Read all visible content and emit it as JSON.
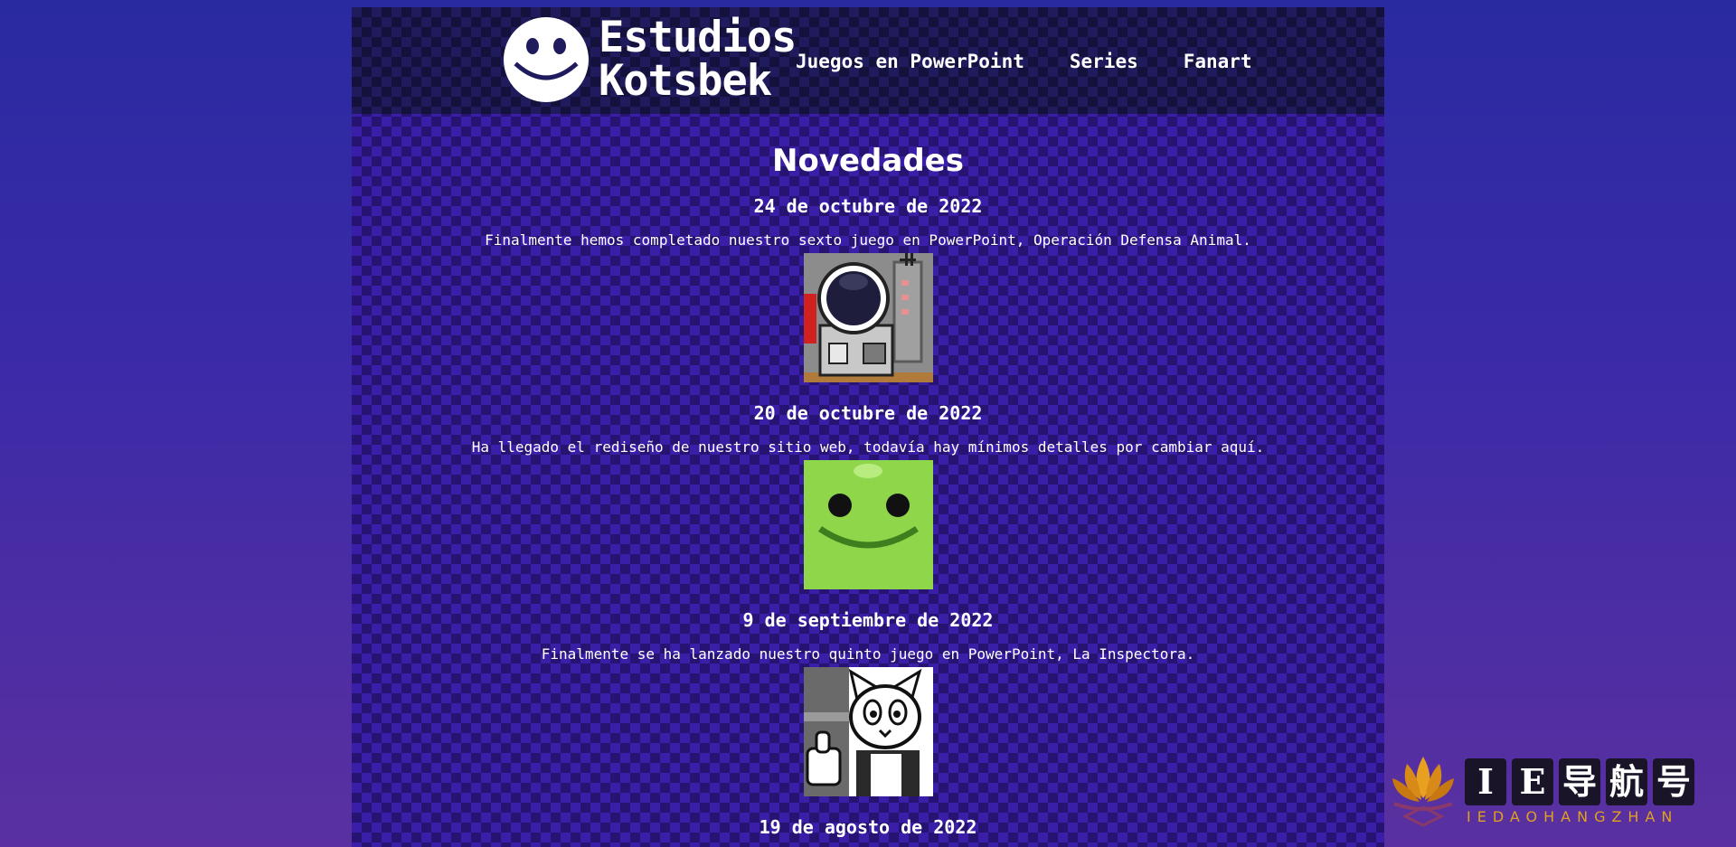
{
  "header": {
    "logo_line1": "Estudios",
    "logo_line2": "Kotsbek",
    "nav": [
      "Juegos en PowerPoint",
      "Series",
      "Fanart"
    ]
  },
  "main": {
    "title": "Novedades",
    "entries": [
      {
        "date": "24 de octubre de 2022",
        "text": "Finalmente hemos completado nuestro sexto juego en PowerPoint, Operación Defensa Animal.",
        "image_icon": "astronaut-pixel-art"
      },
      {
        "date": "20 de octubre de 2022",
        "text": "Ha llegado el rediseño de nuestro sitio web, todavía hay mínimos detalles por cambiar aquí.",
        "image_icon": "green-smiley-pixel-art"
      },
      {
        "date": "9 de septiembre de 2022",
        "text": "Finalmente se ha lanzado nuestro quinto juego en PowerPoint, La Inspectora.",
        "image_icon": "cat-thumbs-up-pixel-art"
      },
      {
        "date": "19 de agosto de 2022",
        "text": "",
        "image_icon": ""
      }
    ]
  },
  "watermark": {
    "chars": [
      "I",
      "E",
      "导",
      "航",
      "号"
    ],
    "sub": "IEDAOHANGZHAN"
  },
  "colors": {
    "page_bg": "#3a1ea8",
    "header_bg": "#1f1b5c",
    "text": "#ffffff",
    "smiley_green": "#8fd64a",
    "watermark_gold": "#e0a020"
  }
}
